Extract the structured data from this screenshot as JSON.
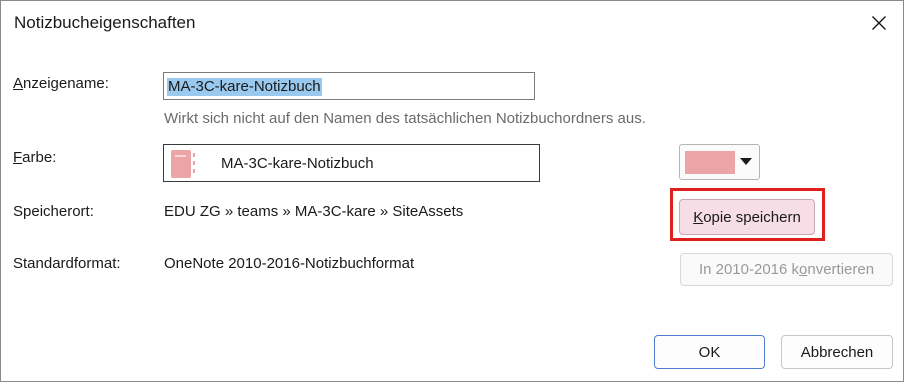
{
  "dialog": {
    "title": "Notizbucheigenschaften",
    "close_icon": "close-icon"
  },
  "display_name": {
    "label_mnemonic": "A",
    "label_rest": "nzeigename:",
    "value": "MA-3C-kare-Notizbuch",
    "hint": "Wirkt sich nicht auf den Namen des tatsächlichen Notizbuchordners aus."
  },
  "color": {
    "label_mnemonic": "F",
    "label_rest": "arbe:",
    "notebook_name": "MA-3C-kare-Notizbuch",
    "notebook_icon": "notebook-icon",
    "swatch_color": "#eba5a6",
    "dropdown_icon": "caret-down-icon"
  },
  "location": {
    "label": "Speicherort:",
    "value": "EDU ZG » teams » MA-3C-kare » SiteAssets",
    "save_copy_mnemonic": "K",
    "save_copy_rest": "opie speichern"
  },
  "format": {
    "label": "Standardformat:",
    "value": "OneNote 2010-2016-Notizbuchformat",
    "convert_before": "In 2010-2016 k",
    "convert_mnemonic": "o",
    "convert_after": "nvertieren"
  },
  "footer": {
    "ok_label": "OK",
    "cancel_label": "Abbrechen"
  },
  "colors": {
    "highlight_border": "#e0201c",
    "selection": "#99c9ef",
    "save_copy_bg": "#f6dde6",
    "ok_border": "#4f7fd0"
  }
}
